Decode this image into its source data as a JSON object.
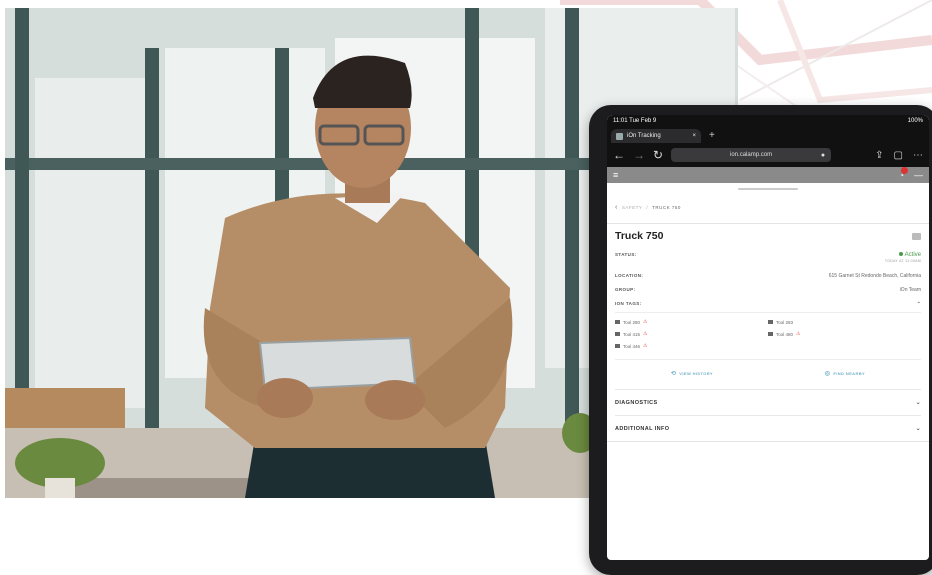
{
  "tablet": {
    "statusbar": {
      "time": "11:01  Tue Feb 9",
      "battery": "100%"
    },
    "browser_tab": {
      "title": "iOn Tracking",
      "close": "×",
      "new_tab": "+"
    },
    "url": "ion.calamp.com",
    "breadcrumb": {
      "parent": "SAFETY",
      "separator": "/",
      "current": "TRUCK 750"
    },
    "asset_title": "Truck 750",
    "status": {
      "label": "STATUS:",
      "value": "Active",
      "sub": "TODAY AT 11:00AM"
    },
    "location": {
      "label": "LOCATION:",
      "value": "615 Garnet St Redondo Beach, California"
    },
    "group": {
      "label": "GROUP:",
      "value": "iOn Team"
    },
    "ion_tags": {
      "label": "ION TAGS:",
      "items": [
        {
          "name": "Tool 280",
          "warning": true
        },
        {
          "name": "Tool 283",
          "warning": false
        },
        {
          "name": "Tool 415",
          "warning": true
        },
        {
          "name": "Tool 480",
          "warning": true
        },
        {
          "name": "Tool 446",
          "warning": true
        }
      ]
    },
    "actions": {
      "view_history": "VIEW HISTORY",
      "find_nearby": "FIND NEARBY"
    },
    "sections": {
      "diagnostics": "DIAGNOSTICS",
      "additional_info": "ADDITIONAL INFO"
    }
  },
  "colors": {
    "active": "#4a9a4a",
    "warning": "#e05a4a",
    "link": "#6fb0c8",
    "appbar": "#8a8a8a"
  }
}
